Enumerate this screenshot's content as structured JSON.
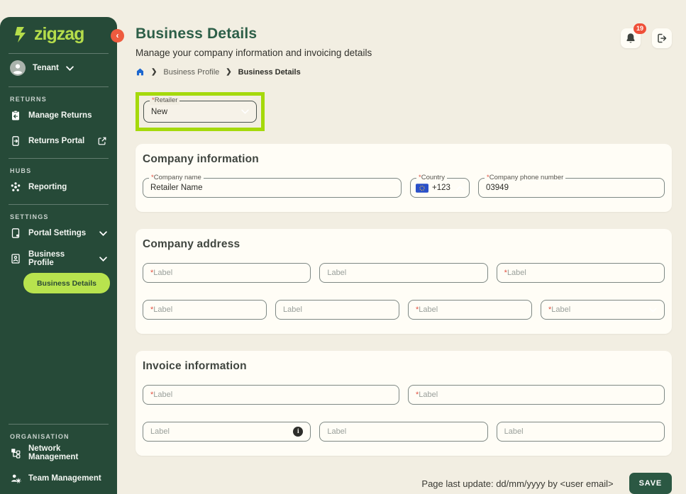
{
  "brand": {
    "logo": "zigzag"
  },
  "sidebar": {
    "tenant_label": "Tenant",
    "sections": [
      {
        "heading": "RETURNS",
        "items": [
          {
            "label": "Manage Returns"
          },
          {
            "label": "Returns Portal"
          }
        ]
      },
      {
        "heading": "HUBS",
        "items": [
          {
            "label": "Reporting"
          }
        ]
      },
      {
        "heading": "SETTINGS",
        "items": [
          {
            "label": "Portal Settings"
          },
          {
            "label": "Business Profile"
          }
        ],
        "active_subitem": "Business Details"
      },
      {
        "heading": "ORGANISATION",
        "items": [
          {
            "label": "Network Management"
          },
          {
            "label": "Team Management"
          }
        ]
      }
    ]
  },
  "header": {
    "title": "Business Details",
    "subtitle": "Manage your company information and invoicing details",
    "breadcrumb": {
      "level1": "Business Profile",
      "level2": "Business Details"
    },
    "notification_count": "19"
  },
  "retailer_select": {
    "required_mark": "*",
    "label": "Retailer",
    "value": "New"
  },
  "company_information": {
    "title": "Company information",
    "company_name": {
      "required_mark": "*",
      "label": "Company name",
      "value": "Retailer Name"
    },
    "country": {
      "required_mark": "*",
      "label": "Country",
      "value": "+123"
    },
    "phone": {
      "required_mark": "*",
      "label": "Company phone number",
      "value": "03949"
    }
  },
  "company_address": {
    "title": "Company address",
    "row1": [
      {
        "required_mark": "*",
        "placeholder": "Label"
      },
      {
        "required_mark": "",
        "placeholder": "Label"
      },
      {
        "required_mark": "*",
        "placeholder": "Label"
      }
    ],
    "row2": [
      {
        "required_mark": "*",
        "placeholder": "Label"
      },
      {
        "required_mark": "",
        "placeholder": "Label"
      },
      {
        "required_mark": "*",
        "placeholder": "Label"
      },
      {
        "required_mark": "*",
        "placeholder": "Label"
      }
    ]
  },
  "invoice_information": {
    "title": "Invoice information",
    "row1": [
      {
        "required_mark": "*",
        "placeholder": "Label"
      },
      {
        "required_mark": "*",
        "placeholder": "Label"
      }
    ],
    "row2": [
      {
        "required_mark": "",
        "placeholder": "Label"
      },
      {
        "required_mark": "",
        "placeholder": "Label"
      },
      {
        "required_mark": "",
        "placeholder": "Label"
      }
    ]
  },
  "footer": {
    "last_update": "Page last update: dd/mm/yyyy by <user email>",
    "save_label": "SAVE"
  },
  "icons": {
    "logo": "zigzag-bolt-icon",
    "collapse": "chevron-left-icon",
    "tenant": "avatar-icon",
    "manage_returns": "clipboard-return-icon",
    "returns_portal": "portal-phone-icon",
    "returns_portal_trailing": "external-link-icon",
    "reporting": "network-dots-icon",
    "portal_settings": "tablet-icon",
    "business_profile": "id-badge-icon",
    "network_management": "org-chart-icon",
    "team_management": "user-gear-icon",
    "breadcrumb_home": "home-icon",
    "notifications": "bell-icon",
    "logout": "logout-icon",
    "country_flag": "eu-flag-icon",
    "info": "info-icon"
  },
  "colors": {
    "sidebar_green": "#264a38",
    "accent_lime": "#b5dd4b",
    "active_pill_lime": "#b8e34e",
    "highlight_annotation": "#a5d90b",
    "collapse_orange": "#ee5b3f",
    "badge_red": "#ef4f38",
    "title_green": "#2d5f48",
    "save_button_green": "#2b5843",
    "required_red": "#e25141",
    "background_cream": "#f2eee2",
    "card_white": "#fffdf6",
    "breadcrumb_home_blue": "#1b66cf",
    "flag_blue": "#2a50c8"
  }
}
